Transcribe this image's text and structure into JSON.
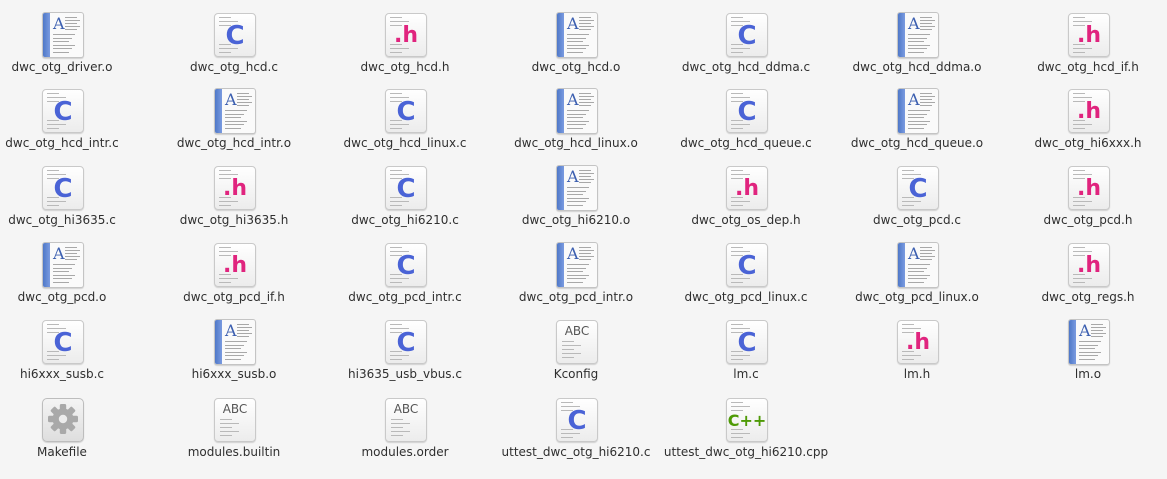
{
  "files": [
    {
      "name": "dwc_otg_driver.o",
      "kind": "obj"
    },
    {
      "name": "dwc_otg_hcd.c",
      "kind": "c"
    },
    {
      "name": "dwc_otg_hcd.h",
      "kind": "h"
    },
    {
      "name": "dwc_otg_hcd.o",
      "kind": "obj"
    },
    {
      "name": "dwc_otg_hcd_ddma.c",
      "kind": "c"
    },
    {
      "name": "dwc_otg_hcd_ddma.o",
      "kind": "obj"
    },
    {
      "name": "dwc_otg_hcd_if.h",
      "kind": "h"
    },
    {
      "name": "dwc_otg_hcd_intr.c",
      "kind": "c"
    },
    {
      "name": "dwc_otg_hcd_intr.o",
      "kind": "obj"
    },
    {
      "name": "dwc_otg_hcd_linux.c",
      "kind": "c"
    },
    {
      "name": "dwc_otg_hcd_linux.o",
      "kind": "obj"
    },
    {
      "name": "dwc_otg_hcd_queue.c",
      "kind": "c"
    },
    {
      "name": "dwc_otg_hcd_queue.o",
      "kind": "obj"
    },
    {
      "name": "dwc_otg_hi6xxx.h",
      "kind": "h"
    },
    {
      "name": "dwc_otg_hi3635.c",
      "kind": "c"
    },
    {
      "name": "dwc_otg_hi3635.h",
      "kind": "h"
    },
    {
      "name": "dwc_otg_hi6210.c",
      "kind": "c"
    },
    {
      "name": "dwc_otg_hi6210.o",
      "kind": "obj"
    },
    {
      "name": "dwc_otg_os_dep.h",
      "kind": "h"
    },
    {
      "name": "dwc_otg_pcd.c",
      "kind": "c"
    },
    {
      "name": "dwc_otg_pcd.h",
      "kind": "h"
    },
    {
      "name": "dwc_otg_pcd.o",
      "kind": "obj"
    },
    {
      "name": "dwc_otg_pcd_if.h",
      "kind": "h"
    },
    {
      "name": "dwc_otg_pcd_intr.c",
      "kind": "c"
    },
    {
      "name": "dwc_otg_pcd_intr.o",
      "kind": "obj"
    },
    {
      "name": "dwc_otg_pcd_linux.c",
      "kind": "c"
    },
    {
      "name": "dwc_otg_pcd_linux.o",
      "kind": "obj"
    },
    {
      "name": "dwc_otg_regs.h",
      "kind": "h"
    },
    {
      "name": "hi6xxx_susb.c",
      "kind": "c"
    },
    {
      "name": "hi6xxx_susb.o",
      "kind": "obj"
    },
    {
      "name": "hi3635_usb_vbus.c",
      "kind": "c"
    },
    {
      "name": "Kconfig",
      "kind": "text"
    },
    {
      "name": "lm.c",
      "kind": "c"
    },
    {
      "name": "lm.h",
      "kind": "h"
    },
    {
      "name": "lm.o",
      "kind": "obj"
    },
    {
      "name": "Makefile",
      "kind": "make"
    },
    {
      "name": "modules.builtin",
      "kind": "text"
    },
    {
      "name": "modules.order",
      "kind": "text"
    },
    {
      "name": "uttest_dwc_otg_hi6210.c",
      "kind": "c"
    },
    {
      "name": "uttest_dwc_otg_hi6210.cpp",
      "kind": "cpp"
    }
  ],
  "glyphs": {
    "c": "C",
    "h": ".h",
    "cpp": "C++",
    "text": "ABC",
    "obj": "A"
  },
  "colors": {
    "c_glyph": "#4a63d6",
    "h_glyph": "#e0247e",
    "cpp_glyph": "#4e9a06",
    "obj_spine": "#4f78c8",
    "background": "#f5f5f5"
  }
}
